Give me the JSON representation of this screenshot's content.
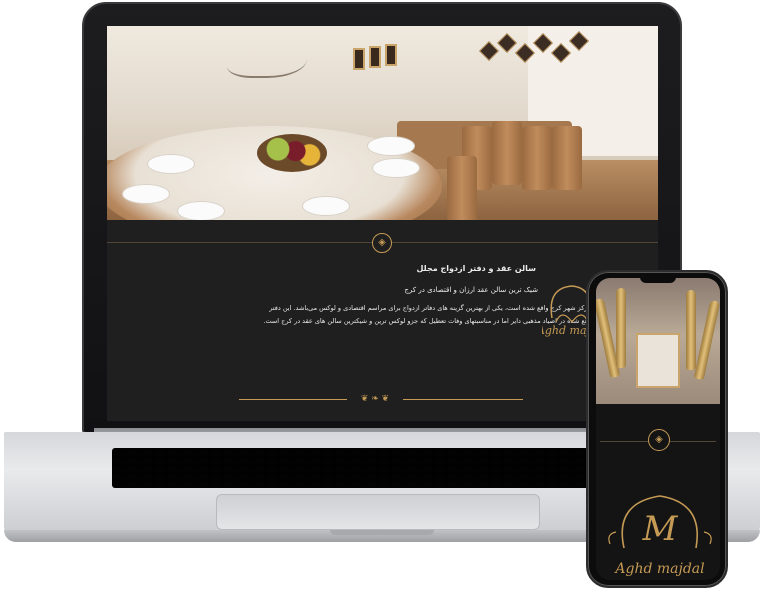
{
  "website": {
    "section_title": "سالن عقد و دفتر ازدواج مجلل",
    "subtitle": "شیک ترین سالن عقد ارزان و اقتصادی در کرج",
    "paragraph_line1": "سالن عقد مجلل که در مرکز شهر کرج  واقع شده است، یکی از بهترین گزینه های دفاتر ازدواج برای مراسم اقتصادی و لوکس می‌باشد. این دفتر",
    "paragraph_line2": "ازدواج در خیابان نبوت واقع شده در  اصیاد مذهبی دایر اما در مناسبتهای وفات تعطیل که جزو لوکس ترین و شیکترین سالن های عقد در کرج است.",
    "divider_glyph": "◈",
    "ornament_glyph": "❦ ❧ ❦",
    "logo_text": "Aghd majdal",
    "logo_monogram": "M"
  },
  "phone": {
    "divider_glyph": "◈",
    "logo_text": "Aghd majdal",
    "logo_monogram": "M"
  },
  "colors": {
    "accent_gold": "#c59a55",
    "dark_bg": "#1f1f1f"
  }
}
